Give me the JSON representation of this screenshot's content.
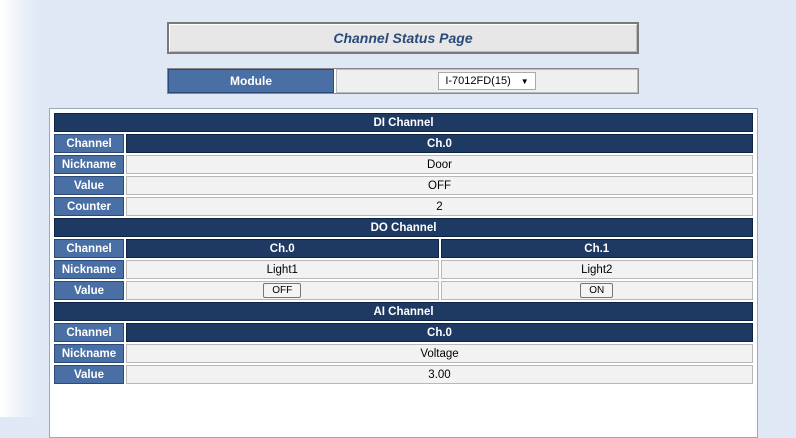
{
  "title": "Channel Status Page",
  "module": {
    "label": "Module",
    "selected": "I-7012FD(15)"
  },
  "di": {
    "header": "DI Channel",
    "channel_label": "Channel",
    "channel": "Ch.0",
    "nickname_label": "Nickname",
    "nickname": "Door",
    "value_label": "Value",
    "value": "OFF",
    "counter_label": "Counter",
    "counter": "2"
  },
  "do": {
    "header": "DO Channel",
    "channel_label": "Channel",
    "nickname_label": "Nickname",
    "value_label": "Value",
    "channels": [
      {
        "name": "Ch.0",
        "nickname": "Light1",
        "value": "OFF"
      },
      {
        "name": "Ch.1",
        "nickname": "Light2",
        "value": "ON"
      }
    ]
  },
  "ai": {
    "header": "AI Channel",
    "channel_label": "Channel",
    "channel": "Ch.0",
    "nickname_label": "Nickname",
    "nickname": "Voltage",
    "value_label": "Value",
    "value": "3.00"
  }
}
